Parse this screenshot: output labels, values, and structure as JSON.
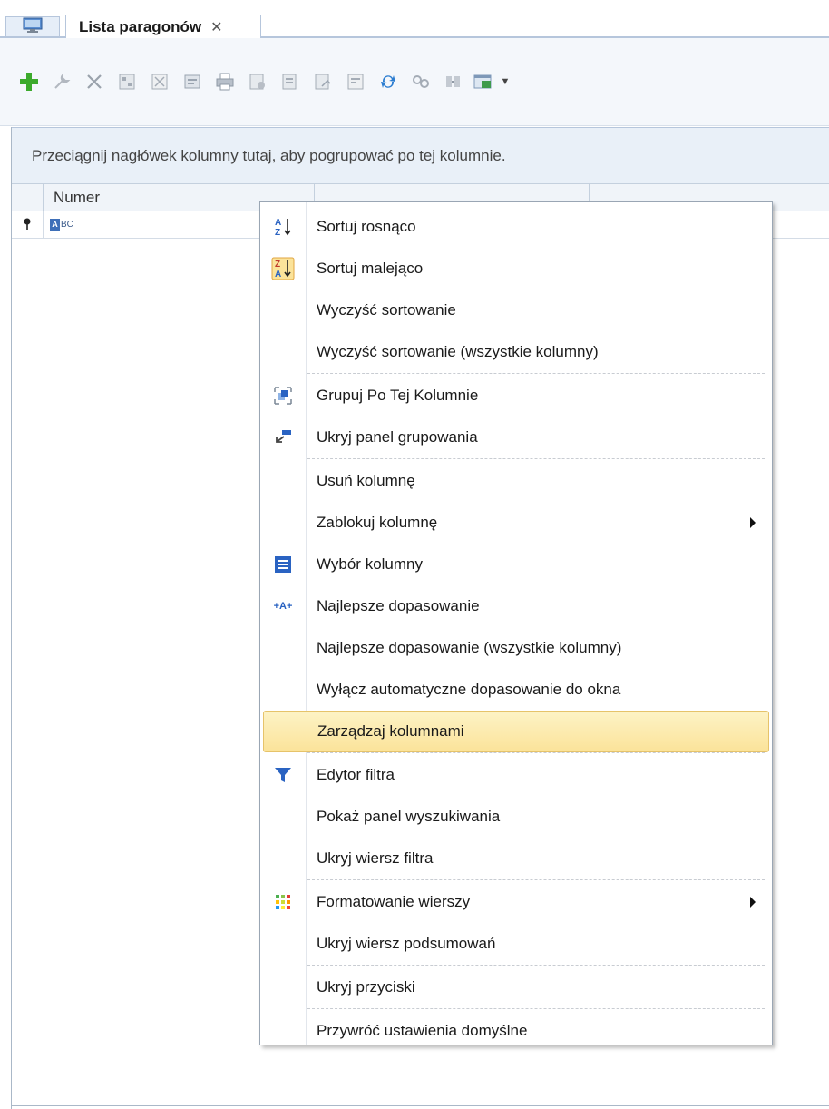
{
  "tabs": {
    "home_icon": "monitor-icon",
    "active_label": "Lista paragonów",
    "close_glyph": "✕"
  },
  "toolbar": {
    "icons": [
      "add-icon",
      "wrench-icon",
      "delete-icon",
      "calc-icon",
      "cancel-doc-icon",
      "preview-icon",
      "print-icon",
      "settings-doc-icon",
      "export-doc-icon",
      "import-doc-icon",
      "edit-doc-icon",
      "refresh-icon",
      "link-icon",
      "transfer-icon",
      "excel-export-icon"
    ],
    "dropdown_glyph": "▼"
  },
  "grid": {
    "group_hint": "Przeciągnij nagłówek kolumny tutaj, aby pogrupować po tej kolumnie.",
    "columns": [
      "Numer"
    ],
    "filter_badge_rest": "BC",
    "filter_badge_letter": "A"
  },
  "context_menu": {
    "items": [
      {
        "label": "Sortuj rosnąco",
        "icon": "sort-ascending-icon"
      },
      {
        "label": "Sortuj malejąco",
        "icon": "sort-descending-icon"
      },
      {
        "label": "Wyczyść sortowanie",
        "icon": ""
      },
      {
        "label": "Wyczyść sortowanie (wszystkie kolumny)",
        "icon": ""
      },
      {
        "label": "Grupuj Po Tej Kolumnie",
        "icon": "group-by-column-icon"
      },
      {
        "label": "Ukryj panel grupowania",
        "icon": "group-panel-icon"
      },
      {
        "label": "Usuń kolumnę",
        "icon": ""
      },
      {
        "label": "Zablokuj kolumnę",
        "icon": "",
        "submenu": true
      },
      {
        "label": "Wybór kolumny",
        "icon": "column-chooser-icon"
      },
      {
        "label": "Najlepsze dopasowanie",
        "icon": "best-fit-icon"
      },
      {
        "label": "Najlepsze dopasowanie (wszystkie kolumny)",
        "icon": ""
      },
      {
        "label": "Wyłącz automatyczne dopasowanie do okna",
        "icon": ""
      },
      {
        "label": "Zarządzaj kolumnami",
        "icon": "",
        "highlighted": true
      },
      {
        "label": "Edytor filtra",
        "icon": "filter-icon"
      },
      {
        "label": "Pokaż panel wyszukiwania",
        "icon": ""
      },
      {
        "label": "Ukryj wiersz filtra",
        "icon": ""
      },
      {
        "label": "Formatowanie wierszy",
        "icon": "conditional-format-icon",
        "submenu": true
      },
      {
        "label": "Ukryj wiersz podsumowań",
        "icon": ""
      },
      {
        "label": "Ukryj przyciski",
        "icon": ""
      },
      {
        "label": "Przywróć ustawienia domyślne",
        "icon": ""
      }
    ],
    "best_fit_glyph": "+A+",
    "sort_asc_glyph": "A Z",
    "sort_desc_glyph": "Z A"
  }
}
